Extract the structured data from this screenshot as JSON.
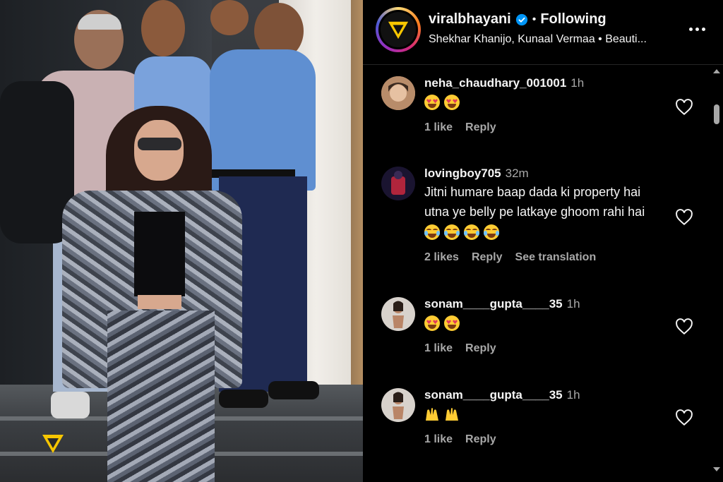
{
  "post": {
    "username": "viralbhayani",
    "follow_status": "Following",
    "tagged_line": "Shekhar Khanijo, Kunaal Vermaa • Beauti..."
  },
  "comments": [
    {
      "username": "neha_chaudhary_001001",
      "time": "1h",
      "text": "",
      "emoji": [
        "heart-eyes",
        "heart-eyes"
      ],
      "likes": "1 like",
      "reply": "Reply",
      "translation": ""
    },
    {
      "username": "lovingboy705",
      "time": "32m",
      "text": "Jitni humare baap dada ki property hai utna ye belly pe latkaye ghoom rahi hai",
      "emoji": [
        "laugh",
        "laugh",
        "laugh",
        "laugh"
      ],
      "likes": "2 likes",
      "reply": "Reply",
      "translation": "See translation"
    },
    {
      "username": "sonam____gupta____35",
      "time": "1h",
      "text": "",
      "emoji": [
        "heart-eyes",
        "heart-eyes"
      ],
      "likes": "1 like",
      "reply": "Reply",
      "translation": ""
    },
    {
      "username": "sonam____gupta____35",
      "time": "1h",
      "text": "",
      "emoji": [
        "raised-hands",
        "raised-hands"
      ],
      "likes": "1 like",
      "reply": "Reply",
      "translation": ""
    }
  ],
  "colors": {
    "background": "#000000",
    "secondary_text": "#a8a8a8",
    "verified_blue": "#0095f6",
    "brand_yellow": "#f7c600"
  },
  "icons": {
    "verified": "verified-badge-icon",
    "more": "more-options-icon",
    "like": "heart-outline-icon",
    "watermark": "viral-bhayani-logo"
  }
}
